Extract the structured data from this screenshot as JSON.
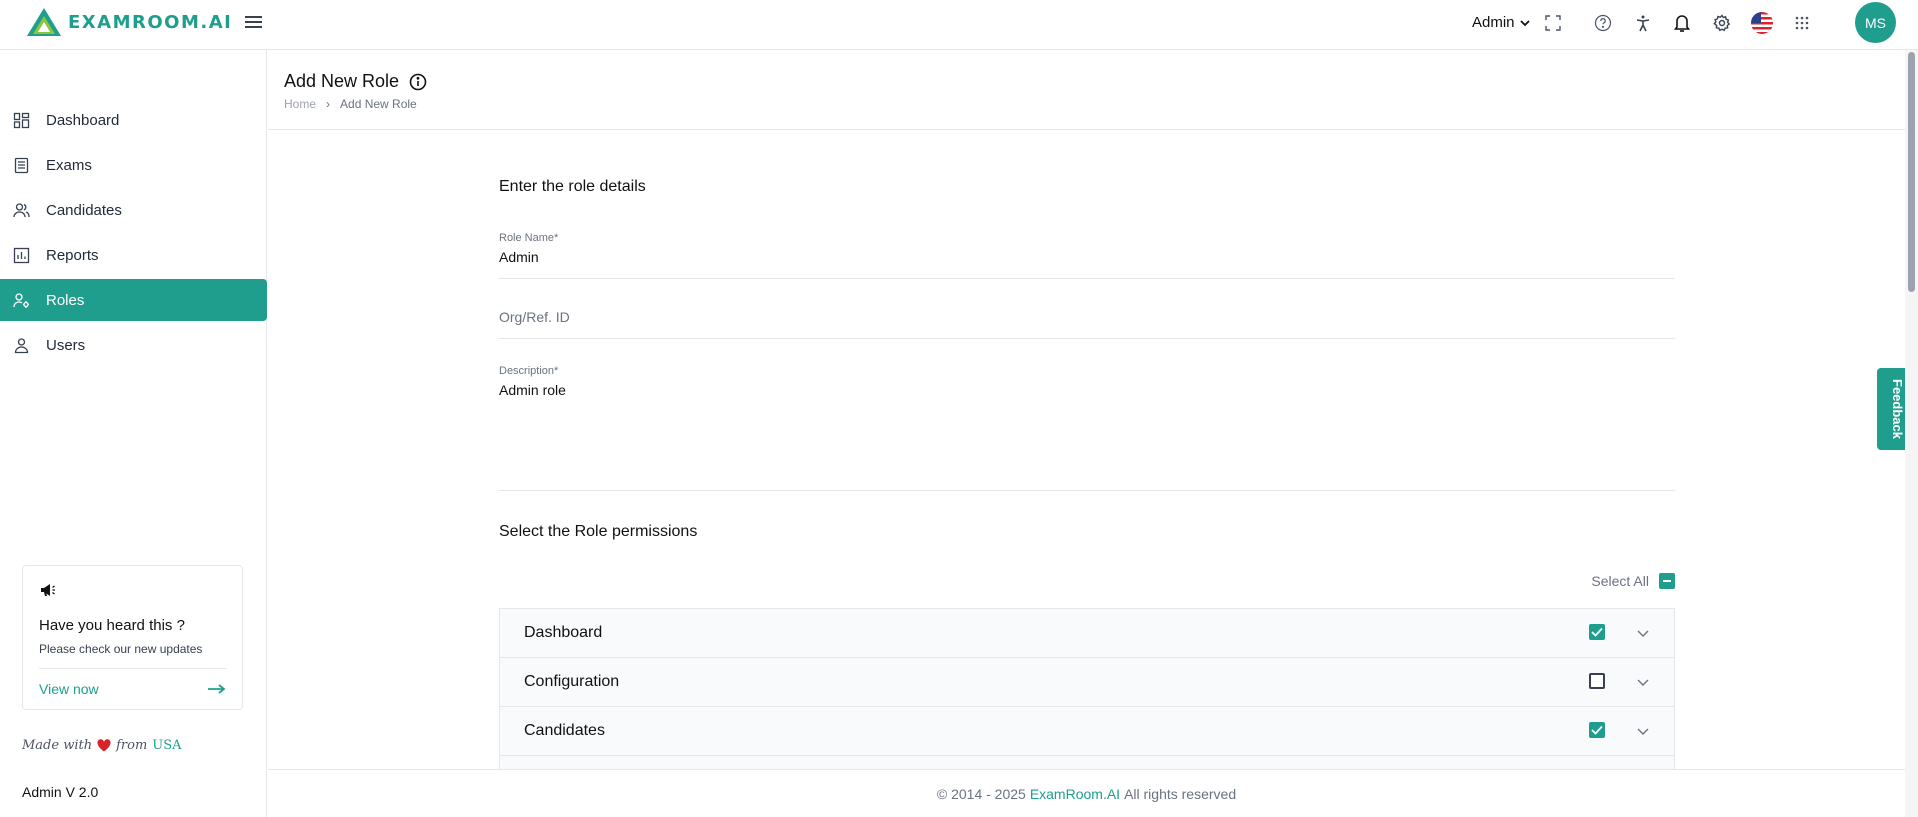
{
  "brand": {
    "logo_text": "EXAMROOM.AI",
    "accent": "#1f9e8e"
  },
  "header": {
    "user_role": "Admin",
    "avatar_initials": "MS",
    "icons": [
      "fullscreen-icon",
      "help-icon",
      "accessibility-icon",
      "bell-icon",
      "gear-icon",
      "us-flag-icon",
      "apps-grid-icon"
    ]
  },
  "sidebar": {
    "items": [
      {
        "label": "Dashboard",
        "icon": "dashboard-icon",
        "active": false
      },
      {
        "label": "Exams",
        "icon": "exams-icon",
        "active": false
      },
      {
        "label": "Candidates",
        "icon": "candidates-icon",
        "active": false
      },
      {
        "label": "Reports",
        "icon": "reports-icon",
        "active": false
      },
      {
        "label": "Roles",
        "icon": "roles-icon",
        "active": true
      },
      {
        "label": "Users",
        "icon": "user-icon",
        "active": false
      }
    ],
    "promo": {
      "title": "Have you heard this ?",
      "subtitle": "Please check our new updates",
      "link": "View now"
    },
    "made_with_prefix": "Made with",
    "made_with_middle": "from",
    "made_with_country": "USA",
    "version": "Admin V 2.0"
  },
  "page": {
    "title": "Add New Role",
    "breadcrumb": {
      "home": "Home",
      "current": "Add New Role",
      "separator": "›"
    }
  },
  "form": {
    "details_title": "Enter the role details",
    "role_name": {
      "label": "Role Name*",
      "value": "Admin"
    },
    "org_ref": {
      "placeholder": "Org/Ref. ID"
    },
    "description": {
      "label": "Description*",
      "value": "Admin role"
    },
    "permissions_title": "Select the Role permissions",
    "select_all_label": "Select All",
    "permissions": [
      {
        "name": "Dashboard",
        "checked": true
      },
      {
        "name": "Configuration",
        "checked": false
      },
      {
        "name": "Candidates",
        "checked": true
      }
    ]
  },
  "footer": {
    "copyright": "© 2014 - 2025",
    "brand": "ExamRoom.AI",
    "rights": "All rights reserved"
  },
  "feedback_label": "Feedback"
}
